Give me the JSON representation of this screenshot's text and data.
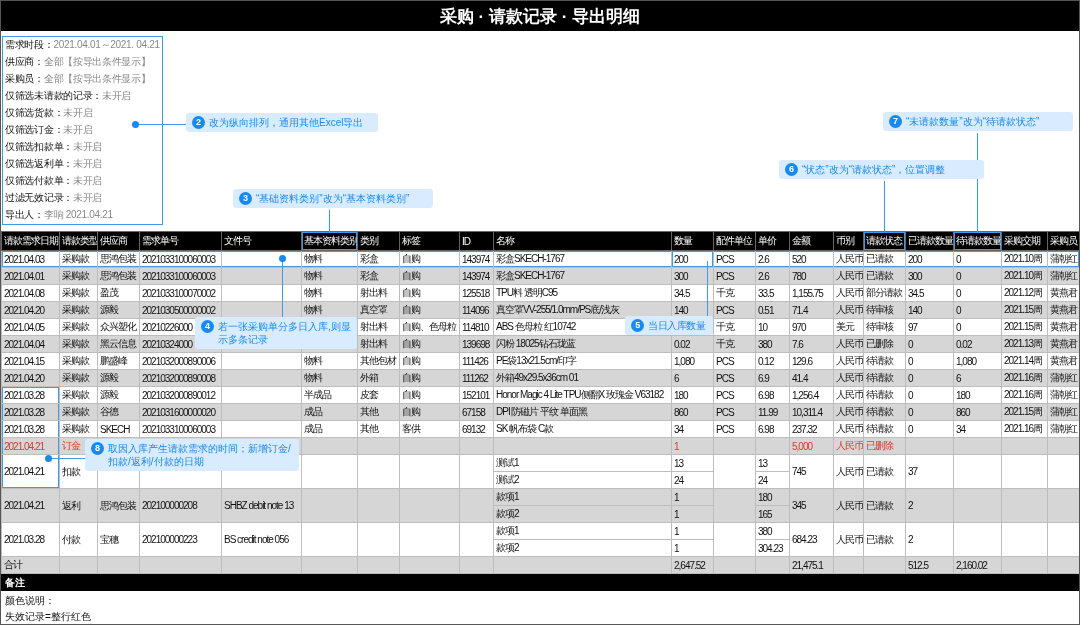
{
  "title": "采购 · 请款记录 · 导出明细",
  "filters": [
    {
      "label": "需求时段：",
      "value": "2021.04.01～2021. 04.21"
    },
    {
      "label": "供应商：",
      "value": "全部【按导出条件显示】"
    },
    {
      "label": "采购员：",
      "value": "全部【按导出条件显示】"
    },
    {
      "label": "仅筛选未请款的记录：",
      "value": "未开启"
    },
    {
      "label": "仅筛选货款：",
      "value": "未开启"
    },
    {
      "label": "仅筛选订金：",
      "value": "未开启"
    },
    {
      "label": "仅筛选扣款单：",
      "value": "未开启"
    },
    {
      "label": "仅筛选返利单：",
      "value": "未开启"
    },
    {
      "label": "仅筛选付款单：",
      "value": "未开启"
    },
    {
      "label": "过滤无效记录：",
      "value": "未开启"
    },
    {
      "label": "导出人：",
      "value": "李响  2021.04.21"
    }
  ],
  "table": {
    "columns": [
      "请款需求日期",
      "请款类型",
      "供应商",
      "需求单号",
      "文件号",
      "基本资料类别",
      "类别",
      "标签",
      "ID",
      "名称",
      "数量",
      "配件单位",
      "单价",
      "金额",
      "币别",
      "请款状态",
      "已请款数量",
      "待请款数量",
      "采购交期",
      "采购员"
    ],
    "rows": [
      {
        "deleted": false,
        "cells": [
          "2021.04.03",
          "采购款",
          "思鸿包装",
          "2021033100060003",
          null,
          "物料",
          "彩盒",
          "自购",
          "143974",
          "彩盒SKECH-1767",
          "200",
          "PCS",
          "2.6",
          "520",
          "人民币",
          "已请款",
          "200",
          "0",
          "2021.10周",
          "蒲朝红"
        ]
      },
      {
        "deleted": false,
        "cells": [
          "2021.04.01",
          "采购款",
          "思鸿包装",
          "2021033100060003",
          null,
          "物料",
          "彩盒",
          "自购",
          "143974",
          "彩盒SKECH-1767",
          "300",
          "PCS",
          "2.6",
          "780",
          "人民币",
          "已请款",
          "300",
          "0",
          "2021.10周",
          "蒲朝红"
        ]
      },
      {
        "deleted": false,
        "cells": [
          "2021.04.08",
          "采购款",
          "盈茂",
          "2021033100070002",
          null,
          "物料",
          "射出料",
          "自购",
          "125518",
          "TPU料 透明C95",
          "34.5",
          "千克",
          "33.5",
          "1,155.75",
          "人民币",
          "部分请款",
          "34.5",
          "0",
          "2021.12周",
          "黄燕君"
        ]
      },
      {
        "deleted": false,
        "cells": [
          "2021.04.20",
          "采购款",
          "源毅",
          "2021030500000002",
          null,
          "物料",
          "真空罩",
          "自购",
          "114096",
          "真空罩VV-255/1.0mm/PS底/浅灰",
          "140",
          "PCS",
          "0.51",
          "71.4",
          "人民币",
          "待审核",
          "140",
          "0",
          "2021.15周",
          "黄燕君"
        ]
      },
      {
        "deleted": false,
        "cells": [
          "2021.04.05",
          "采购款",
          "众兴塑化",
          "20210226000",
          null,
          null,
          "射出料",
          "自购、色母粒",
          "114810",
          "ABS 色母粒 红10742",
          null,
          "千克",
          "10",
          "970",
          "美元",
          "待审核",
          "97",
          "0",
          "2021.15周",
          "黄燕君"
        ]
      },
      {
        "deleted": false,
        "cells": [
          "2021.04.04",
          "采购款",
          "黑云信息",
          "20210324000",
          null,
          null,
          "射出料",
          "自购",
          "139698",
          "闪粉 18025钻石珑蓝",
          "0.02",
          "千克",
          "380",
          "7.6",
          "人民币",
          "已删除",
          "0",
          "0.02",
          "2021.13周",
          "黄燕君"
        ]
      },
      {
        "deleted": false,
        "cells": [
          "2021.04.15",
          "采购款",
          "鹏盛峰",
          "2021032000890006",
          null,
          "物料",
          "其他包材",
          "自购",
          "111426",
          "PE袋13x21.5cm/印字",
          "1,080",
          "PCS",
          "0.12",
          "129.6",
          "人民币",
          "待请款",
          "0",
          "1,080",
          "2021.14周",
          "黄燕君"
        ]
      },
      {
        "deleted": false,
        "cells": [
          "2021.04.20",
          "采购款",
          "源毅",
          "2021032000890008",
          null,
          "物料",
          "外箱",
          "自购",
          "111262",
          "外箱49x29.5x36cm 01",
          "6",
          "PCS",
          "6.9",
          "41.4",
          "人民币",
          "待请款",
          "0",
          "6",
          "2021.16周",
          "蒲朝红"
        ]
      },
      {
        "deleted": false,
        "cells": [
          "2021.03.28",
          "采购款",
          "源毅",
          "2021032000890012",
          null,
          "半成品",
          "皮套",
          "自购",
          "152101",
          "Honor Magic 4 Lite TPU侧翻X 玫瑰金 V63182",
          "180",
          "PCS",
          "6.98",
          "1,256.4",
          "人民币",
          "待请款",
          "0",
          "180",
          "2021.16周",
          "蒲朝红"
        ]
      },
      {
        "deleted": false,
        "cells": [
          "2021.03.28",
          "采购款",
          "谷德",
          "2021031600000020",
          null,
          "成品",
          "其他",
          "自购",
          "67158",
          "DPI 防磁片 平纹 单面黑",
          "860",
          "PCS",
          "11.99",
          "10,311.4",
          "人民币",
          "待请款",
          "0",
          "860",
          "2021.15周",
          "蒲朝红"
        ]
      },
      {
        "deleted": false,
        "cells": [
          "2021.03.28",
          "采购款",
          "SKECH",
          "2021033100060003",
          null,
          "成品",
          "其他",
          "客供",
          "69132",
          "SK 帆布袋 C款",
          "34",
          "PCS",
          "6.98",
          "237.32",
          "人民币",
          "待请款",
          "0",
          "34",
          "2021.16周",
          "蒲朝红"
        ]
      },
      {
        "deleted": true,
        "cells": [
          "2021.04.21",
          "订金",
          null,
          null,
          null,
          null,
          null,
          null,
          null,
          null,
          "1",
          null,
          null,
          "5,000",
          "人民币",
          "已删除",
          null,
          null,
          null,
          null
        ]
      },
      {
        "deleted": false,
        "cells": [
          "2021.04.21",
          "扣款",
          null,
          null,
          null,
          null,
          null,
          null,
          null,
          [
            "测试1",
            "测试2"
          ],
          [
            "13",
            "24"
          ],
          null,
          [
            "13",
            "24"
          ],
          "745",
          "人民币",
          "已请款",
          "37",
          null,
          null,
          null
        ]
      },
      {
        "deleted": false,
        "cells": [
          "2021.04.21",
          "返利",
          "思鸿包装",
          "202100000208",
          "SHBZ debit note 13",
          null,
          null,
          null,
          null,
          [
            "款项1",
            "款项2"
          ],
          [
            "1",
            "1"
          ],
          null,
          [
            "180",
            "165"
          ],
          "345",
          "人民币",
          "已请款",
          "2",
          null,
          null,
          null
        ]
      },
      {
        "deleted": false,
        "cells": [
          "2021.03.28",
          "付款",
          "宝穗",
          "202100000223",
          "BS credit note 056",
          null,
          null,
          null,
          null,
          [
            "款项1",
            "款项2"
          ],
          [
            "1",
            "1"
          ],
          null,
          [
            "380",
            "304.23"
          ],
          "684.23",
          "人民币",
          "已请款",
          "2",
          null,
          null,
          null
        ]
      },
      {
        "deleted": false,
        "cells": [
          "合计",
          null,
          null,
          null,
          null,
          null,
          null,
          null,
          null,
          null,
          "2,647.52",
          null,
          null,
          "21,475.1",
          null,
          null,
          "512.5",
          "2,160.02",
          null,
          null
        ]
      }
    ]
  },
  "notes": {
    "title": "备注",
    "lines": [
      "颜色说明：",
      "失效记录=整行红色"
    ]
  },
  "annotations": [
    {
      "number": "2",
      "text": "改为纵向排列，通用其他Excel导出"
    },
    {
      "number": "3",
      "text": "“基础资料类别”改为“基本资料类别”"
    },
    {
      "number": "4",
      "text": "若一张采购单分多日入库,则显示多条记录"
    },
    {
      "number": "5",
      "text": "当日入库数量"
    },
    {
      "number": "6",
      "text": "“状态”改为“请款状态”，位置调整"
    },
    {
      "number": "7",
      "text": "“未请款数量”改为“待请款状态”"
    },
    {
      "number": "8",
      "text": "取因入库产生请款需求的时间；新增订金/扣款/返利/付款的日期"
    }
  ]
}
